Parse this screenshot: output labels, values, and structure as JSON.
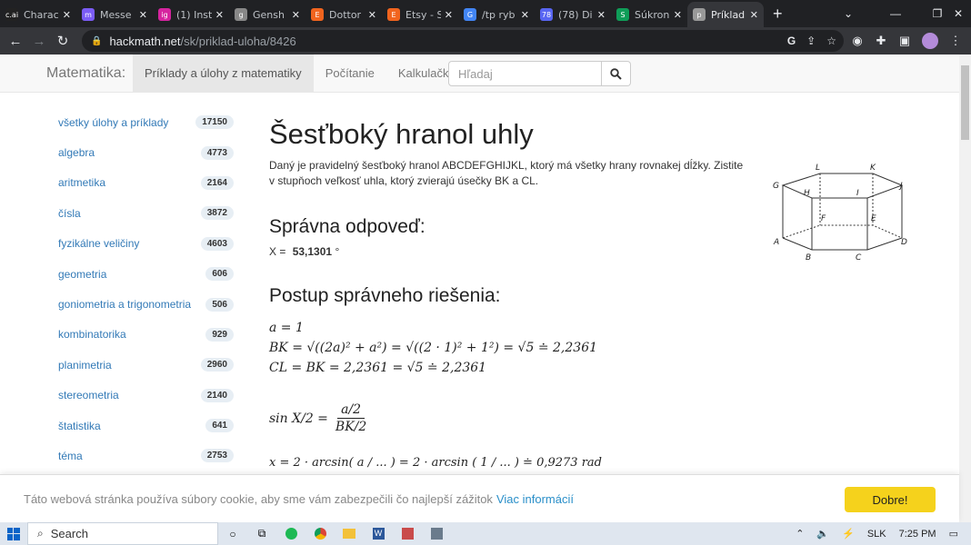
{
  "browser": {
    "tabs": [
      {
        "label": "Charac",
        "icon": "c.ai",
        "color": "#222"
      },
      {
        "label": "Messe",
        "icon": "m",
        "color": "#7b5cf5"
      },
      {
        "label": "(1) Inst",
        "icon": "ig",
        "color": "#d6249f"
      },
      {
        "label": "Gensh",
        "icon": "g",
        "color": "#888"
      },
      {
        "label": "Dottor",
        "icon": "E",
        "color": "#f1641e"
      },
      {
        "label": "Etsy - S",
        "icon": "E",
        "color": "#f1641e"
      },
      {
        "label": "/tp ryb",
        "icon": "G",
        "color": "#4285f4"
      },
      {
        "label": "(78) Di",
        "icon": "78",
        "color": "#5865f2"
      },
      {
        "label": "Súkron",
        "icon": "S",
        "color": "#0f9d58"
      },
      {
        "label": "Príklad",
        "icon": "p",
        "color": "#999",
        "active": true
      }
    ],
    "url_host": "hackmath.net",
    "url_path": "/sk/priklad-uloha/8426"
  },
  "header": {
    "brand": "Matematika:",
    "nav": [
      "Príklady a úlohy z matematiky",
      "Počítanie",
      "Kalkulačky"
    ],
    "search_placeholder": "Hľadaj"
  },
  "sidebar": {
    "items": [
      {
        "label": "všetky úlohy a príklady",
        "count": "17150"
      },
      {
        "label": "algebra",
        "count": "4773"
      },
      {
        "label": "aritmetika",
        "count": "2164"
      },
      {
        "label": "čísla",
        "count": "3872"
      },
      {
        "label": "fyzikálne veličiny",
        "count": "4603"
      },
      {
        "label": "geometria",
        "count": "606"
      },
      {
        "label": "goniometria a trigonometria",
        "count": "506"
      },
      {
        "label": "kombinatorika",
        "count": "929"
      },
      {
        "label": "planimetria",
        "count": "2960"
      },
      {
        "label": "stereometria",
        "count": "2140"
      },
      {
        "label": "štatistika",
        "count": "641"
      },
      {
        "label": "téma",
        "count": "2753"
      }
    ]
  },
  "main": {
    "title": "Šesťboký hranol uhly",
    "description": "Daný je pravidelný šesťboký hranol ABCDEFGHIJKL, ktorý má všetky hrany rovnakej dĺžky. Zistite v stupňoch veľkosť uhla, ktorý zvierajú úsečky BK a CL.",
    "answer_heading": "Správna odpoveď:",
    "answer_label": "X =",
    "answer_value": "53,1301",
    "answer_unit": "°",
    "solution_heading": "Postup správneho riešenia:",
    "math_lines": [
      "a = 1",
      "BK = √((2a)² + a²) = √((2 · 1)² + 1²) = √5 ≐ 2,2361",
      "CL = BK = 2,2361 = √5 ≐ 2,2361"
    ],
    "sin_prefix": "sin X/2 =",
    "sin_num": "a/2",
    "sin_den": "BK/2",
    "partial_line": "x = 2 · arcsin( a / ... ) = 2 · arcsin ( 1 / ... ) ≐ 0,9273 rad"
  },
  "figure": {
    "labels": [
      "L",
      "K",
      "G",
      "H",
      "I",
      "J",
      "F",
      "E",
      "A",
      "D",
      "B",
      "C"
    ]
  },
  "cookie": {
    "text": "Táto webová stránka používa súbory cookie, aby sme vám zabezpečili čo najlepší zážitok",
    "link": "Viac informácií",
    "button": "Dobre!"
  },
  "taskbar": {
    "search": "Search",
    "lang": "SLK",
    "time": "7:25 PM"
  }
}
